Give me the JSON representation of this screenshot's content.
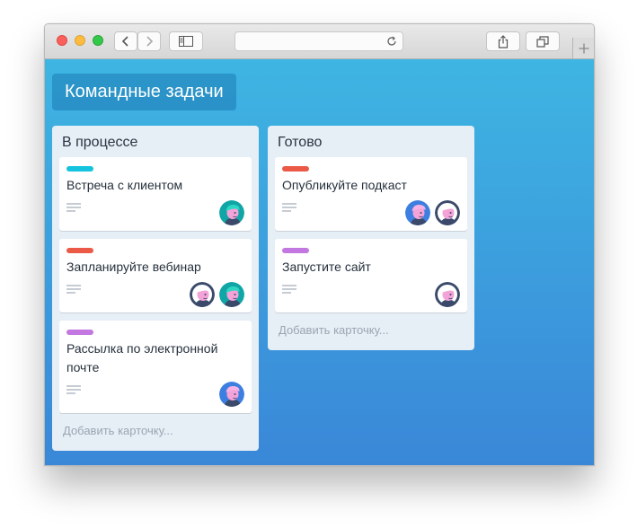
{
  "browser": {
    "address": "",
    "icons": {
      "back": "chevron-left-icon",
      "forward": "chevron-right-icon",
      "sidebar": "sidebar-icon",
      "reload": "reload-icon",
      "share": "share-icon",
      "tabs": "tabs-icon",
      "new_tab": "plus-icon"
    }
  },
  "board": {
    "title": "Командные задачи",
    "lists": [
      {
        "title": "В процессе",
        "add_card": "Добавить карточку...",
        "cards": [
          {
            "label_color": "#14c3dd",
            "title": "Встреча с клиентом",
            "avatars": [
              "teal"
            ]
          },
          {
            "label_color": "#ea5a47",
            "title": "Запланируйте вебинар",
            "avatars": [
              "white",
              "teal"
            ]
          },
          {
            "label_color": "#c377e0",
            "title": "Рассылка по электронной почте",
            "avatars": [
              "blue"
            ]
          }
        ]
      },
      {
        "title": "Готово",
        "add_card": "Добавить карточку...",
        "cards": [
          {
            "label_color": "#ea5a47",
            "title": "Опубликуйте подкаст",
            "avatars": [
              "blue",
              "white"
            ]
          },
          {
            "label_color": "#c377e0",
            "title": "Запустите сайт",
            "avatars": [
              "white"
            ]
          }
        ]
      }
    ]
  },
  "colors": {
    "background_top": "#3eb5e2",
    "background_bottom": "#3a87d8",
    "list_bg": "#e6eef6"
  }
}
